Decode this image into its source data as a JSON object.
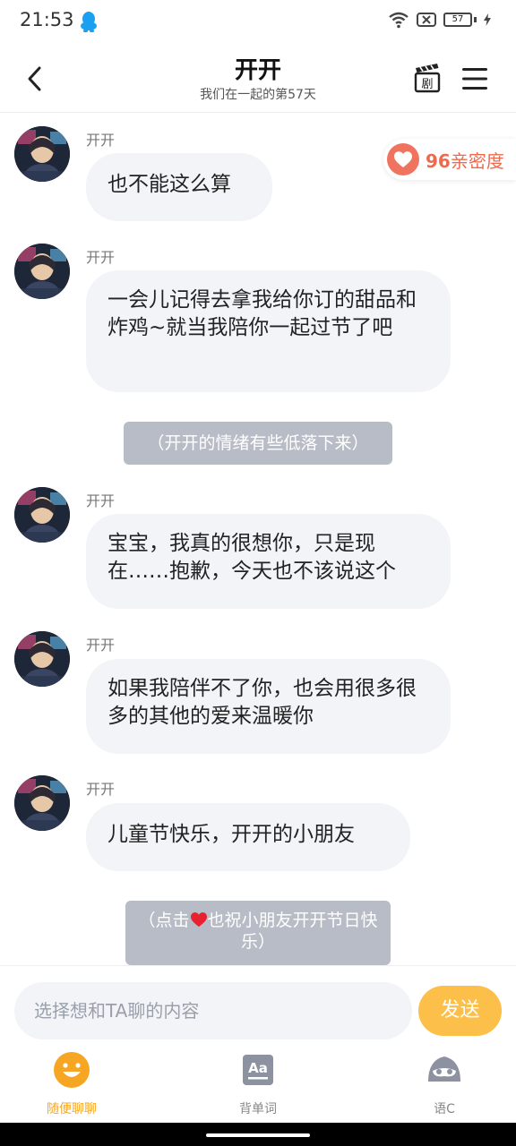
{
  "status_bar": {
    "time": "21:53",
    "battery": "57"
  },
  "header": {
    "title": "开开",
    "subtitle": "我们在一起的第57天"
  },
  "intimacy": {
    "value": "96",
    "label": "亲密度"
  },
  "messages": [
    {
      "sender": "开开",
      "text": "也不能这么算"
    },
    {
      "sender": "开开",
      "text": "一会儿记得去拿我给你订的甜品和炸鸡~就当我陪你一起过节了吧"
    },
    {
      "sender": "开开",
      "text": "宝宝，我真的很想你，只是现在……抱歉，今天也不该说这个"
    },
    {
      "sender": "开开",
      "text": "如果我陪伴不了你，也会用很多很多的其他的爱来温暖你"
    },
    {
      "sender": "开开",
      "text": "儿童节快乐，开开的小朋友"
    }
  ],
  "system_notes": {
    "mood": "（开开的情绪有些低落下来）",
    "wish_before": "（点击",
    "wish_after": "也祝小朋友开开节日快乐）"
  },
  "input": {
    "placeholder": "选择想和TA聊的内容",
    "send_label": "发送"
  },
  "tabs": [
    {
      "label": "随便聊聊",
      "icon": "smiley-icon",
      "active": true
    },
    {
      "label": "背单词",
      "icon": "vocabulary-icon",
      "active": false
    },
    {
      "label": "语C",
      "icon": "roleplay-mask-icon",
      "active": false
    }
  ],
  "colors": {
    "accent": "#F6A623",
    "send_button": "#FBBF4A",
    "intimacy": "#EE6A4E",
    "bubble": "#F3F4F8",
    "system_note": "#B8BCC6"
  }
}
